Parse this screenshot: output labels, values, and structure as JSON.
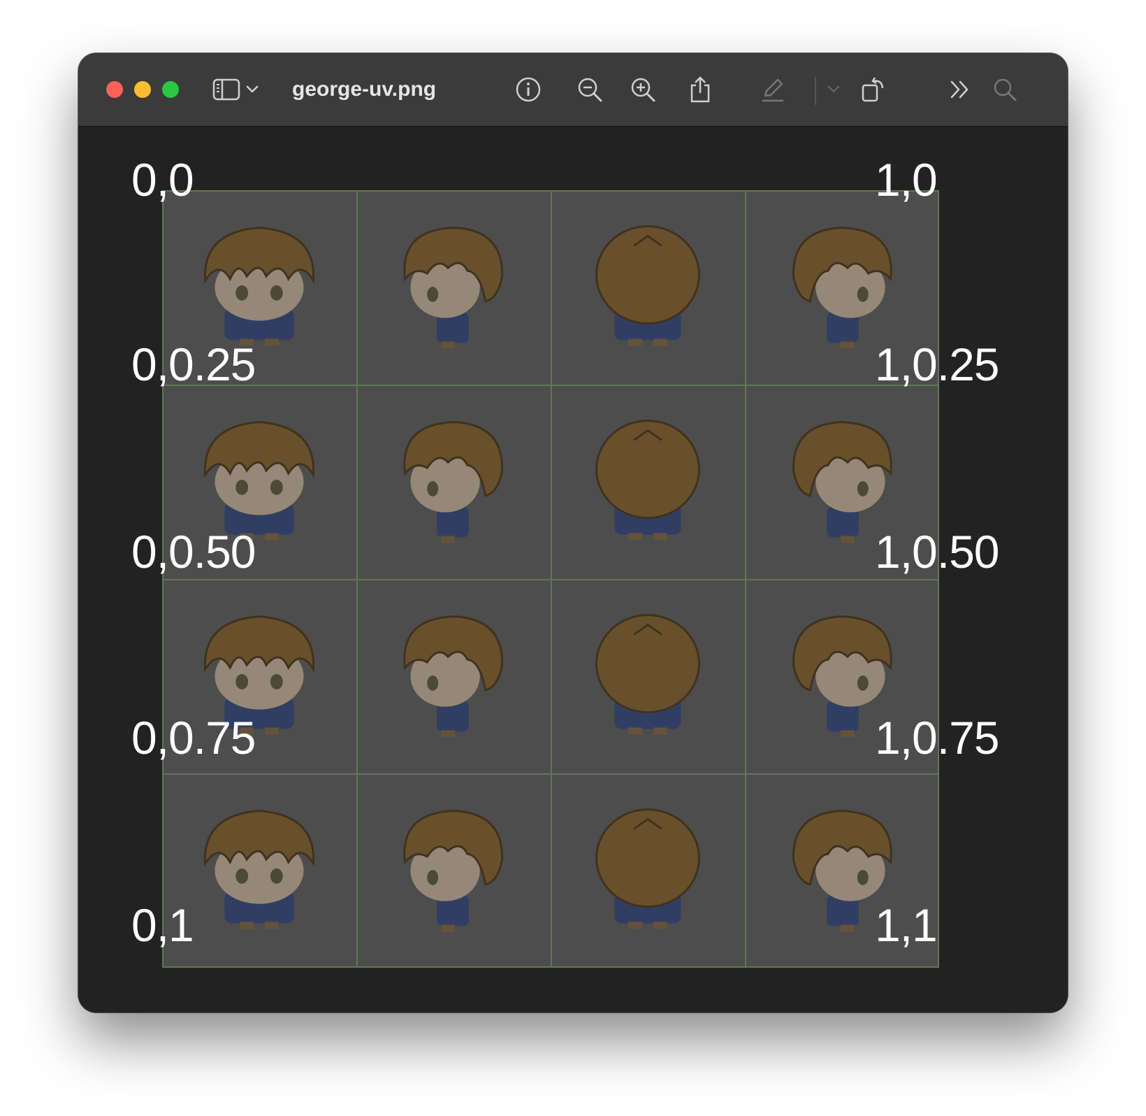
{
  "window": {
    "title": "george-uv.png"
  },
  "toolbar": {
    "buttons": [
      {
        "name": "sidebar-toggle",
        "icon": "sidebar-icon"
      },
      {
        "name": "sidebar-menu",
        "icon": "chevron-down-icon"
      },
      {
        "name": "info",
        "icon": "info-icon"
      },
      {
        "name": "zoom-out",
        "icon": "zoom-out-icon"
      },
      {
        "name": "zoom-in",
        "icon": "zoom-in-icon"
      },
      {
        "name": "share",
        "icon": "share-icon"
      },
      {
        "name": "markup",
        "icon": "pencil-icon",
        "disabled": true
      },
      {
        "name": "markup-menu",
        "icon": "chevron-down-icon",
        "disabled": true
      },
      {
        "name": "rotate",
        "icon": "rotate-icon"
      },
      {
        "name": "more",
        "icon": "chevrons-right-icon"
      },
      {
        "name": "search",
        "icon": "search-icon",
        "disabled": true
      }
    ]
  },
  "colors": {
    "titlebar": "#3b3b3b",
    "content_bg": "#222222",
    "sheet_bg": "#4d4d4d",
    "grid": "#5c7a52",
    "hair": "#6e5126",
    "skin": "#a69680",
    "shirt": "#2b3b6a"
  },
  "sprite_sheet": {
    "rows": 4,
    "columns": 4,
    "column_facing": [
      "front",
      "right",
      "back",
      "left"
    ]
  },
  "labels": {
    "top_left": "0,0",
    "top_right": "1,0",
    "left_025": "0,0.25",
    "right_025": "1,0.25",
    "left_050": "0,0.50",
    "right_050": "1,0.50",
    "left_075": "0,0.75",
    "right_075": "1,0.75",
    "bottom_left": "0,1",
    "bottom_right": "1,1"
  }
}
